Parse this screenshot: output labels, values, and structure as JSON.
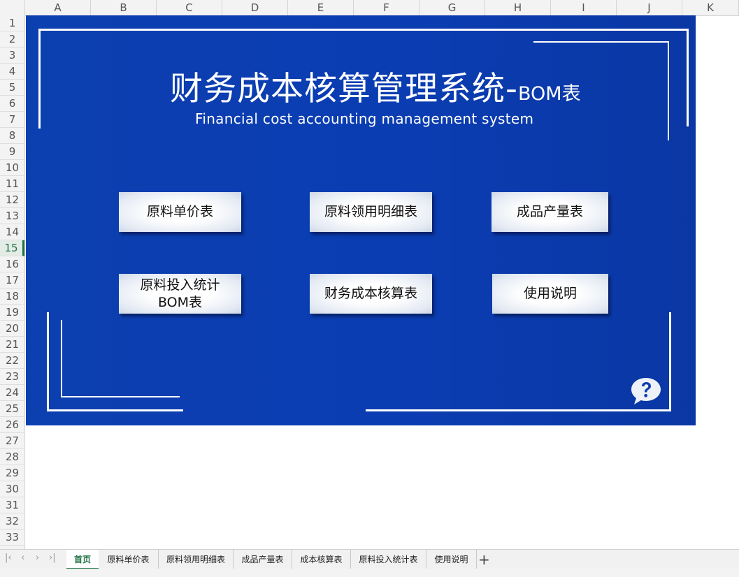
{
  "columns": [
    "A",
    "B",
    "C",
    "D",
    "E",
    "F",
    "G",
    "H",
    "I",
    "J",
    "K"
  ],
  "rows": [
    "1",
    "2",
    "3",
    "4",
    "5",
    "6",
    "7",
    "8",
    "9",
    "10",
    "11",
    "12",
    "13",
    "14",
    "15",
    "16",
    "17",
    "18",
    "19",
    "20",
    "21",
    "22",
    "23",
    "24",
    "25",
    "26",
    "27",
    "28",
    "29",
    "30",
    "31",
    "32",
    "33"
  ],
  "selected_row": "15",
  "dashboard": {
    "title": "财务成本核算管理系统-",
    "title_suffix": "BOM表",
    "subtitle": "Financial cost accounting management system",
    "buttons": {
      "raw_price": "原料单价表",
      "raw_usage": "原料领用明细表",
      "output": "成品产量表",
      "raw_input_line1": "原料投入统计",
      "raw_input_line2": "BOM表",
      "cost_calc": "财务成本核算表",
      "instructions": "使用说明"
    }
  },
  "tabs": [
    "首页",
    "原料单价表",
    "原料领用明细表",
    "成品产量表",
    "成本核算表",
    "原料投入统计表",
    "使用说明"
  ],
  "active_tab": "首页",
  "colors": {
    "banner": "#0c3fb0",
    "accent": "#217346"
  }
}
